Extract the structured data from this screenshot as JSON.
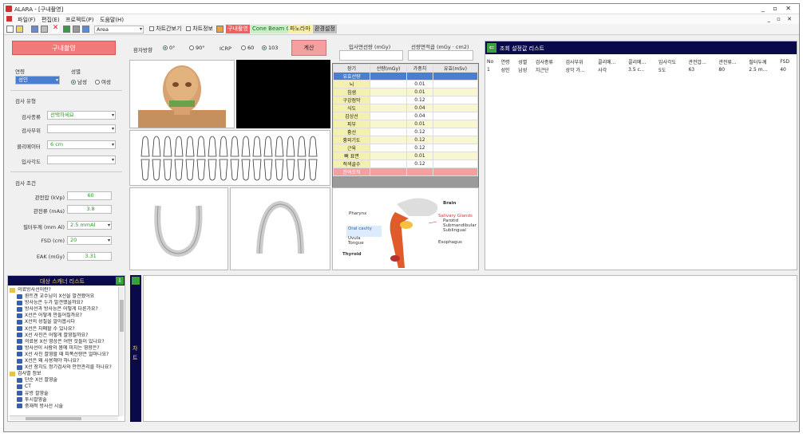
{
  "window": {
    "title": "ALARA - [구내촬영]",
    "controls": "_ ▫ ✕",
    "mdi_controls": "_ ▫ ✕"
  },
  "menu": [
    "파일(F)",
    "편집(E)",
    "프로젝트(P)",
    "도움말(H)"
  ],
  "toolbar": {
    "area_value": "Area",
    "chart_simple": "차트간보기",
    "chart_info": "차트정보",
    "buttons": [
      {
        "label": "구내촬영",
        "bg": "#f06060",
        "fg": "#ffffff"
      },
      {
        "label": "Cone Beam CT",
        "bg": "#c8f0c8",
        "fg": "#1a6a1a"
      },
      {
        "label": "파노라마",
        "bg": "#f8f0a0",
        "fg": "#333333"
      },
      {
        "label": "환경설정",
        "bg": "#c0c0c0",
        "fg": "#222222"
      }
    ]
  },
  "left": {
    "title_button": "구내촬영",
    "age_label": "연령",
    "age_value": "성인",
    "sex_label": "성별",
    "sex_options": [
      "남성",
      "여성"
    ],
    "exam_section": "검사 유형",
    "exam_fields": [
      {
        "label": "검사종류",
        "value": "선택하세요"
      },
      {
        "label": "검사부위",
        "value": ""
      },
      {
        "label": "콜리메이터",
        "value": "6 cm"
      },
      {
        "label": "입사각도",
        "value": ""
      }
    ],
    "cond_section": "검사 조건",
    "cond_fields": [
      {
        "label": "관전압 (kVp)",
        "value": "60"
      },
      {
        "label": "관전류 (mAs)",
        "value": "3.8"
      },
      {
        "label": "필터두께 (mm Al)",
        "value": "2.5 mmAl"
      },
      {
        "label": "FSD (cm)",
        "value": "20"
      },
      {
        "label": "EAK (mGy)",
        "value": "3.31"
      }
    ]
  },
  "patient": {
    "direction_label": "환자방향",
    "direction_options": [
      "0°",
      "90°"
    ],
    "icrp_label": "ICRP",
    "icrp_options": [
      "60",
      "103"
    ],
    "calc_button": "계산"
  },
  "organ": {
    "entry_label": "입사면선량 (mGy)",
    "area_label": "선량면적곱 (mGy · cm2)",
    "headers": [
      "장기",
      "선량(mGy)",
      "가중치",
      "유효(mSv)"
    ],
    "rows": [
      {
        "organ": "유효선량",
        "w": "",
        "hl": "#4a7fd0"
      },
      {
        "organ": "뇌",
        "w": "0.01"
      },
      {
        "organ": "침샘",
        "w": "0.01"
      },
      {
        "organ": "구강점막",
        "w": "0.12"
      },
      {
        "organ": "식도",
        "w": "0.04"
      },
      {
        "organ": "갑상선",
        "w": "0.04"
      },
      {
        "organ": "피부",
        "w": "0.01"
      },
      {
        "organ": "흉선",
        "w": "0.12"
      },
      {
        "organ": "흉외기도",
        "w": "0.12"
      },
      {
        "organ": "근육",
        "w": "0.12"
      },
      {
        "organ": "뼈 표면",
        "w": "0.01"
      },
      {
        "organ": "적색골수",
        "w": "0.12"
      },
      {
        "organ": "잔여조직",
        "w": "",
        "hl": "#f4a0a0"
      }
    ]
  },
  "anatomy": {
    "labels": [
      "Brain",
      "Pharynx",
      "Salivary Glands",
      "Parotid",
      "Submandibular",
      "Sublingual",
      "Oral cavity",
      "Uvula",
      "Tongue",
      "Esophagus",
      "Thyroid"
    ]
  },
  "results": {
    "title": "조회 설정값 리스트",
    "headers": [
      "No",
      "연령",
      "성별",
      "검사종류",
      "검사부위",
      "콜리메...",
      "콜리메...",
      "입사각도",
      "관전압...",
      "관전류...",
      "필터두께",
      "FSD"
    ],
    "rows": [
      [
        "1",
        "성인",
        "남성",
        "치근단",
        "상악 가...",
        "사각",
        "3.5 c...",
        "5도",
        "63",
        "80",
        "2.5 m...",
        "40"
      ]
    ]
  },
  "scanner": {
    "title": "대상 스캐너 리스트",
    "items": [
      {
        "t": "folder",
        "label": "의료방사선이란?"
      },
      {
        "t": "doc",
        "label": "뢴트겐 교수님이 X선을 발견했어요"
      },
      {
        "t": "doc",
        "label": "방사능은 누가 발견했을까요?"
      },
      {
        "t": "doc",
        "label": "방사선과 방사능은 어떻게 다른가요?"
      },
      {
        "t": "doc",
        "label": "X선은 어떻게 만들어질까요?"
      },
      {
        "t": "doc",
        "label": "X선의 성질을 알아봅시다"
      },
      {
        "t": "doc",
        "label": "X선은 차폐할 수 있나요?"
      },
      {
        "t": "doc",
        "label": "X선 사진은 어떻게 촬영될까요?"
      },
      {
        "t": "doc",
        "label": "의료용 X선 영상은 어떤 것들이 있나요?"
      },
      {
        "t": "doc",
        "label": "방사선이 사람의 몸에 미치는 영향은?"
      },
      {
        "t": "doc",
        "label": "X선 사진 촬영할 때 피폭선량은 얼마나요?"
      },
      {
        "t": "doc",
        "label": "X선은 왜 사용해야 하나요?"
      },
      {
        "t": "doc",
        "label": "X선 장치도 정기검사와 안전관리를 하나요?"
      },
      {
        "t": "folder",
        "label": "검사별 정보"
      },
      {
        "t": "doc",
        "label": "단순 X선 촬영술"
      },
      {
        "t": "doc",
        "label": "CT"
      },
      {
        "t": "doc",
        "label": "유방 촬영술"
      },
      {
        "t": "doc",
        "label": "투시촬영술"
      },
      {
        "t": "doc",
        "label": "중재적 방사선 시술"
      }
    ]
  },
  "side_tab": {
    "label": "차 트"
  }
}
